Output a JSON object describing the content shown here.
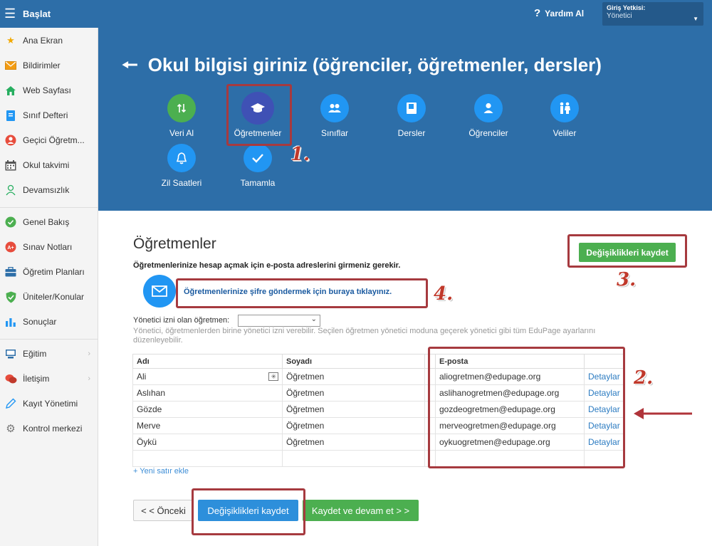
{
  "topbar": {
    "menu_label": "Başlat",
    "help_label": "Yardım Al",
    "role_label": "Giriş Yetkisi:",
    "role_value": "Yönetici"
  },
  "sidebar": {
    "items": [
      {
        "label": "Ana Ekran",
        "icon": "star-icon",
        "color": "#f2a900"
      },
      {
        "label": "Bildirimler",
        "icon": "envelope-icon",
        "color": "#f39c12"
      },
      {
        "label": "Web Sayfası",
        "icon": "home-icon",
        "color": "#27ae60"
      },
      {
        "label": "Sınıf Defteri",
        "icon": "book-icon",
        "color": "#2196f3"
      },
      {
        "label": "Geçici Öğretm...",
        "icon": "substitute-icon",
        "color": "#e74c3c"
      },
      {
        "label": "Okul takvimi",
        "icon": "calendar-icon",
        "color": "#555555"
      },
      {
        "label": "Devamsızlık",
        "icon": "person-icon",
        "color": "#27ae60"
      },
      {
        "label": "Genel Bakış",
        "icon": "check-circle-icon",
        "color": "#4caf50"
      },
      {
        "label": "Sınav Notları",
        "icon": "grades-icon",
        "color": "#e74c3c"
      },
      {
        "label": "Öğretim Planları",
        "icon": "briefcase-icon",
        "color": "#2d6ea8"
      },
      {
        "label": "Üniteler/Konular",
        "icon": "shield-check-icon",
        "color": "#4caf50"
      },
      {
        "label": "Sonuçlar",
        "icon": "bar-chart-icon",
        "color": "#2196f3"
      },
      {
        "label": "Eğitim",
        "icon": "education-icon",
        "color": "#2d6ea8"
      },
      {
        "label": "İletişim",
        "icon": "chat-icon",
        "color": "#e74c3c"
      },
      {
        "label": "Kayıt Yönetimi",
        "icon": "pencil-icon",
        "color": "#2196f3"
      },
      {
        "label": "Kontrol merkezi",
        "icon": "gear-icon",
        "color": "#777777"
      }
    ]
  },
  "banner": {
    "title": "Okul bilgisi giriniz (öğrenciler, öğretmenler, dersler)",
    "steps": [
      {
        "label": "Veri Al",
        "icon": "import-arrows-icon"
      },
      {
        "label": "Öğretmenler",
        "icon": "graduation-cap-icon"
      },
      {
        "label": "Sınıflar",
        "icon": "group-icon"
      },
      {
        "label": "Dersler",
        "icon": "book-icon"
      },
      {
        "label": "Öğrenciler",
        "icon": "person-icon"
      },
      {
        "label": "Veliler",
        "icon": "parents-icon"
      },
      {
        "label": "Zil Saatleri",
        "icon": "bell-icon"
      },
      {
        "label": "Tamamla",
        "icon": "checkmark-icon"
      }
    ]
  },
  "content": {
    "heading": "Öğretmenler",
    "instruction": "Öğretmenlerinize hesap açmak için e-posta adreslerini girmeniz gerekir.",
    "save_label": "Değişiklikleri kaydet",
    "mail_link": "Öğretmenlerinize şifre göndermek için buraya tıklayınız.",
    "admin_label": "Yönetici izni olan öğretmen:",
    "admin_value": "",
    "admin_note": "Yönetici, öğretmenlerden birine yönetici izni verebilir. Seçilen öğretmen yönetici moduna geçerek yönetici gibi tüm EduPage ayarlarını düzenleyebilir.",
    "add_row": "+ Yeni satır ekle"
  },
  "table": {
    "headers": [
      "Adı",
      "Soyadı",
      "",
      "E-posta",
      ""
    ],
    "rows": [
      {
        "first": "Ali",
        "last": "Öğretmen",
        "email": "aliogretmen@edupage.org",
        "action": "Detaylar"
      },
      {
        "first": "Aslıhan",
        "last": "Öğretmen",
        "email": "aslihanogretmen@edupage.org",
        "action": "Detaylar"
      },
      {
        "first": "Gözde",
        "last": "Öğretmen",
        "email": "gozdeogretmen@edupage.org",
        "action": "Detaylar"
      },
      {
        "first": "Merve",
        "last": "Öğretmen",
        "email": "merveogretmen@edupage.org",
        "action": "Detaylar"
      },
      {
        "first": "Öykü",
        "last": "Öğretmen",
        "email": "oykuogretmen@edupage.org",
        "action": "Detaylar"
      }
    ]
  },
  "footer": {
    "prev": "< < Önceki",
    "save": "Değişiklikleri kaydet",
    "next": "Kaydet ve devam et > >"
  },
  "annotations": [
    "1.",
    "2.",
    "3.",
    "4."
  ],
  "colors": {
    "primary": "#2d6ea8",
    "green": "#4caf50",
    "blue": "#2196f3",
    "annotation_red": "#a63a3f"
  }
}
